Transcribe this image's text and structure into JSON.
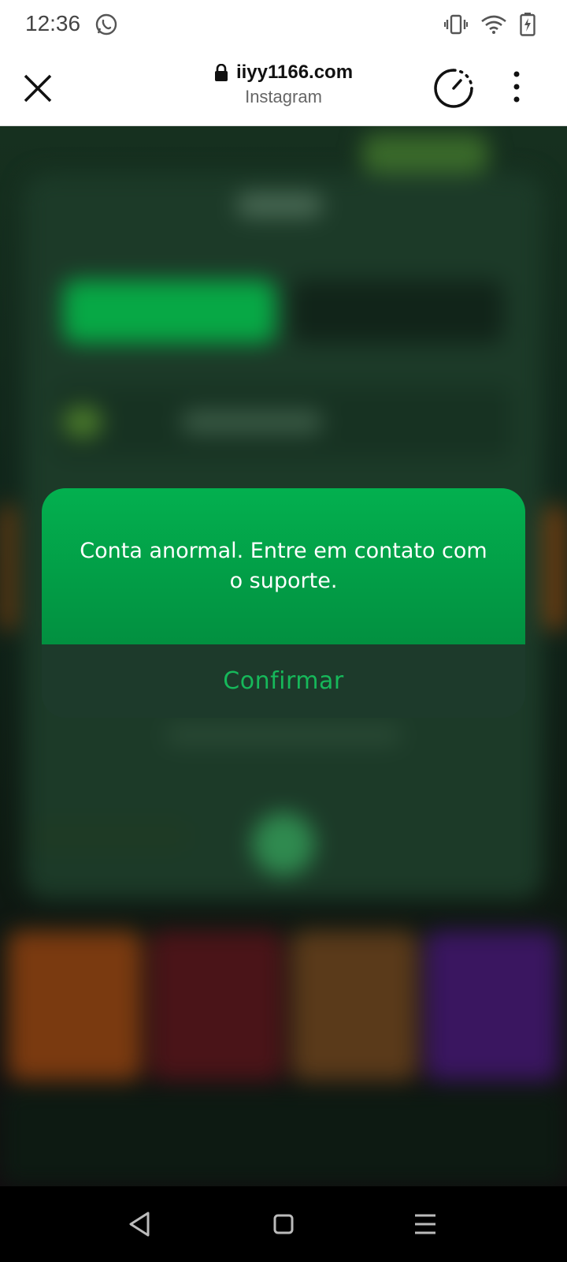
{
  "status_bar": {
    "time": "12:36",
    "icons": [
      "whatsapp-icon",
      "vibrate-icon",
      "wifi-icon",
      "battery-charging-icon"
    ]
  },
  "browser": {
    "url": "iiyy1166.com",
    "source": "Instagram",
    "icons": [
      "close-icon",
      "lock-icon",
      "timer-icon",
      "more-vert-icon"
    ]
  },
  "dialog": {
    "message": "Conta anormal. Entre em contato com o suporte.",
    "confirm_label": "Confirmar"
  },
  "nav_bar": {
    "icons": [
      "back-icon",
      "home-icon",
      "recents-icon"
    ]
  },
  "colors": {
    "accent": "#03b04f",
    "dialog_bottom": "#1d3a2b",
    "confirm_text": "#16b85a"
  }
}
